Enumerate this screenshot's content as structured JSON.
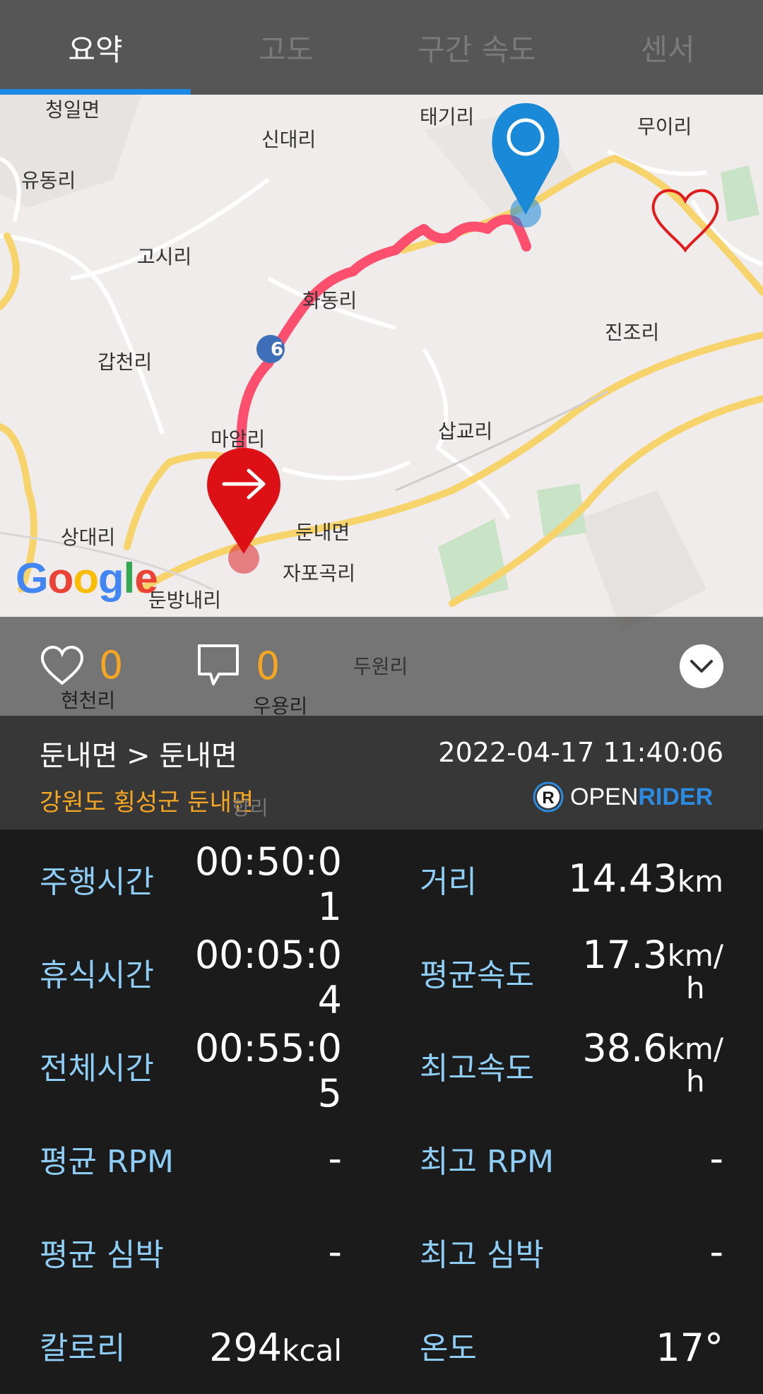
{
  "tabs": [
    {
      "label": "요약",
      "active": true
    },
    {
      "label": "고도",
      "active": false
    },
    {
      "label": "구간 속도",
      "active": false
    },
    {
      "label": "센서",
      "active": false
    }
  ],
  "map": {
    "google_label": "Google",
    "route_badge": "6",
    "places": [
      "청일면",
      "태기리",
      "무이리",
      "신대리",
      "유동리",
      "고시리",
      "화동리",
      "진조리",
      "갑천리",
      "마암리",
      "삽교리",
      "상대리",
      "둔내면",
      "자포곡리",
      "둔방내리",
      "두원리",
      "현천리",
      "우용리",
      "향리"
    ]
  },
  "social": {
    "likes": "0",
    "comments": "0"
  },
  "route": {
    "title": "둔내면 > 둔내면",
    "datetime": "2022-04-17 11:40:06",
    "region": "강원도 횡성군 둔내면",
    "brand_open": "OPEN",
    "brand_rider": "RIDER"
  },
  "stats": {
    "ride_time": {
      "label": "주행시간",
      "value_line1": "00:50:0",
      "value_line2": "1"
    },
    "rest_time": {
      "label": "휴식시간",
      "value_line1": "00:05:0",
      "value_line2": "4"
    },
    "total_time": {
      "label": "전체시간",
      "value_line1": "00:55:0",
      "value_line2": "5"
    },
    "distance": {
      "label": "거리",
      "value": "14.43",
      "unit": "km"
    },
    "avg_speed": {
      "label": "평균속도",
      "value": "17.3",
      "unit_line1": "km/",
      "unit_line2": "h"
    },
    "max_speed": {
      "label": "최고속도",
      "value": "38.6",
      "unit_line1": "km/",
      "unit_line2": "h"
    },
    "avg_rpm": {
      "label": "평균 RPM",
      "value": "-"
    },
    "max_rpm": {
      "label": "최고 RPM",
      "value": "-"
    },
    "avg_hr": {
      "label": "평균 심박",
      "value": "-"
    },
    "max_hr": {
      "label": "최고 심박",
      "value": "-"
    },
    "calories": {
      "label": "칼로리",
      "value": "294",
      "unit": "kcal"
    },
    "temperature": {
      "label": "온도",
      "value": "17°"
    }
  },
  "colors": {
    "accent_blue": "#1e88e5",
    "route_red": "#ff4f6e",
    "label_blue": "#8ecdf5",
    "orange": "#f5a623"
  }
}
